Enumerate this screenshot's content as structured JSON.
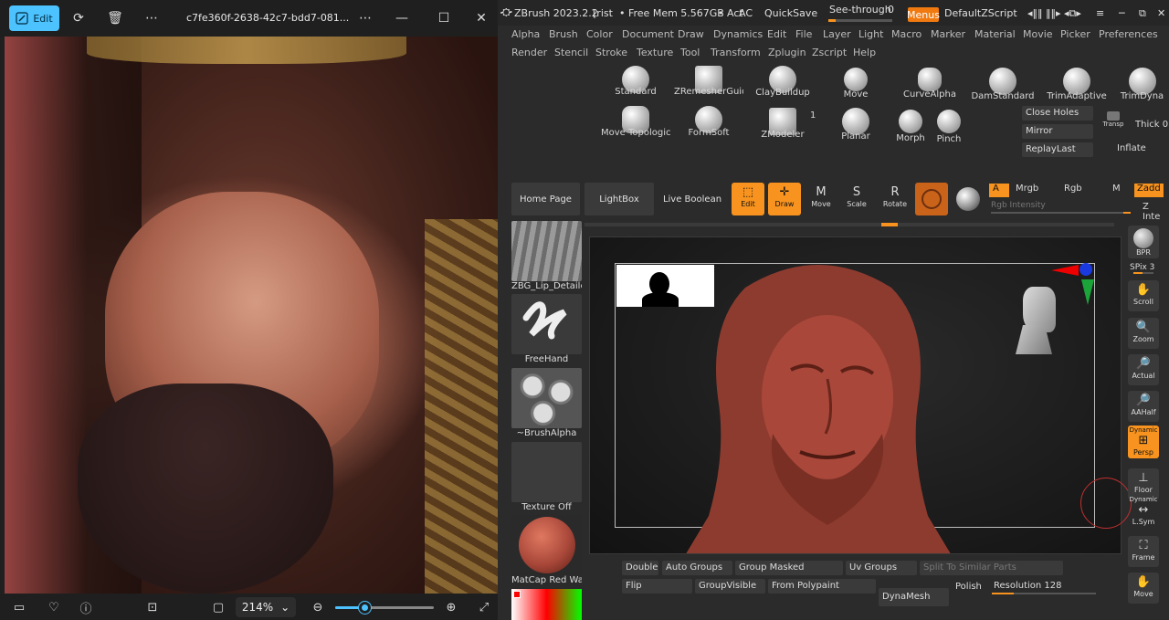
{
  "photos": {
    "edit_label": "Edit",
    "filename": "c7fe360f-2638-42c7-bdd7-081...",
    "zoom_value": "214%",
    "zoom_slider_fraction": 0.3
  },
  "zbrush": {
    "title": "ZBrush 2023.2.2",
    "title_suffix": "[rist",
    "free_mem": "• Free Mem 5.567GB",
    "active": "• Act",
    "ac": "AC",
    "quicksave": "QuickSave",
    "see_through": "See-through",
    "see_through_value": "0",
    "menus": "Menus",
    "script": "DefaultZScript",
    "menu_row1": [
      "Alpha",
      "Brush",
      "Color",
      "Document",
      "Draw",
      "Dynamics",
      "Edit",
      "File",
      "Layer",
      "Light",
      "Macro",
      "Marker",
      "Material",
      "Movie",
      "Picker",
      "Preferences"
    ],
    "menu_row2": [
      "Render",
      "Stencil",
      "Stroke",
      "Texture",
      "Tool",
      "Transform",
      "Zplugin",
      "Zscript",
      "Help"
    ],
    "brushes_row1": [
      "Standard",
      "ZRemesherGuide",
      "ClayBuildup",
      "Move",
      "CurveAlpha",
      "DamStandard",
      "TrimAdaptive",
      "TrimDyna"
    ],
    "brushes_row2": [
      "Move Topologica",
      "FormSoft",
      "ZModeler",
      "Planar",
      "Morph",
      "Pinch"
    ],
    "zmodeler_count": "1",
    "side_buttons": [
      "Close Holes",
      "Mirror",
      "ReplayLast"
    ],
    "transp": "Transp",
    "thick": "Thick 0",
    "inflate": "Inflate",
    "toolbar": {
      "home": "Home Page",
      "lightbox": "LightBox",
      "live_boolean": "Live Boolean",
      "edit": "Edit",
      "draw": "Draw",
      "move": "Move",
      "scale": "Scale",
      "rotate": "Rotate"
    },
    "color_row": {
      "a": "A",
      "mrgb": "Mrgb",
      "rgb": "Rgb",
      "m": "M",
      "zadd": "Zadd",
      "rgb_intensity": "Rgb Intensity",
      "z_intensity": "Z Inte"
    },
    "left_shelf": [
      "ZBG_Lip_Detailer",
      "FreeHand",
      "~BrushAlpha",
      "Texture Off",
      "MatCap Red Wax"
    ],
    "right_tools": [
      "BPR",
      "SPix 3",
      "Scroll",
      "Zoom",
      "Actual",
      "AAHalf",
      "Dynamic",
      "Persp",
      "Floor",
      "Dynamic",
      "L.Sym",
      "Frame",
      "Move"
    ],
    "bottom": {
      "double": "Double",
      "auto_groups": "Auto Groups",
      "group_masked": "Group Masked",
      "uv_groups": "Uv Groups",
      "to_similar": "Split To Similar Parts",
      "flip": "Flip",
      "group_visible": "GroupVisible",
      "from_polypaint": "From Polypaint",
      "dynamesh": "DynaMesh",
      "polish": "Polish",
      "resolution": "Resolution 128"
    },
    "colors": {
      "accent": "#f7931e",
      "clay": "#a9483a"
    }
  }
}
